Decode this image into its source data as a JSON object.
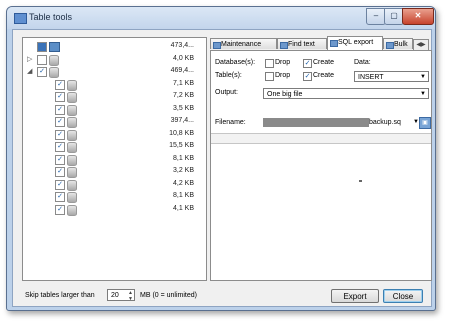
{
  "window": {
    "title": "Table tools",
    "controls": {
      "minimize": "–",
      "maximize": "▢",
      "close": "✕"
    }
  },
  "tree": {
    "rows": [
      {
        "expander": "",
        "checked": "partial",
        "icon": "server-icon",
        "size": "473,4..."
      },
      {
        "expander": "▷",
        "checked": "unchecked",
        "icon": "database-icon",
        "size": "4,0 KB"
      },
      {
        "expander": "◢",
        "checked": "checked",
        "icon": "database-icon",
        "size": "469,4..."
      },
      {
        "expander": "",
        "checked": "checked",
        "icon": "table-icon",
        "size": "7,1 KB"
      },
      {
        "expander": "",
        "checked": "checked",
        "icon": "table-icon",
        "size": "7,2 KB"
      },
      {
        "expander": "",
        "checked": "checked",
        "icon": "table-icon",
        "size": "3,5 KB"
      },
      {
        "expander": "",
        "checked": "checked",
        "icon": "table-icon",
        "size": "397,4..."
      },
      {
        "expander": "",
        "checked": "checked",
        "icon": "table-icon",
        "size": "10,8 KB"
      },
      {
        "expander": "",
        "checked": "checked",
        "icon": "table-icon",
        "size": "15,5 KB"
      },
      {
        "expander": "",
        "checked": "checked",
        "icon": "table-icon",
        "size": "8,1 KB"
      },
      {
        "expander": "",
        "checked": "checked",
        "icon": "table-icon",
        "size": "3,2 KB"
      },
      {
        "expander": "",
        "checked": "checked",
        "icon": "table-icon",
        "size": "4,2 KB"
      },
      {
        "expander": "",
        "checked": "checked",
        "icon": "table-icon",
        "size": "8,1 KB"
      },
      {
        "expander": "",
        "checked": "checked",
        "icon": "table-icon",
        "size": "4,1 KB"
      }
    ]
  },
  "tabs": [
    {
      "label": "Maintenance",
      "active": false
    },
    {
      "label": "Find text",
      "active": false
    },
    {
      "label": "SQL export",
      "active": true
    },
    {
      "label": "Bulk",
      "active": false
    }
  ],
  "tab_scroll": "◀▶",
  "sql_export": {
    "databases_label": "Database(s):",
    "tables_label": "Table(s):",
    "drop_label": "Drop",
    "create_label": "Create",
    "db_drop_checked": false,
    "db_create_checked": true,
    "tbl_drop_checked": false,
    "tbl_create_checked": true,
    "data_label": "Data:",
    "data_value": "INSERT",
    "output_label": "Output:",
    "output_value": "One big file",
    "filename_label": "Filename:",
    "filename_value": "backup.sq"
  },
  "bottom": {
    "skip_label": "Skip tables larger than",
    "skip_value": "20",
    "unit_label": "MB (0 = unlimited)",
    "export_button": "Export",
    "close_button": "Close"
  },
  "colors": {
    "window_frame": "#bcd1ea",
    "close_button": "#c7432d",
    "check_mark": "#1d5fa8"
  }
}
